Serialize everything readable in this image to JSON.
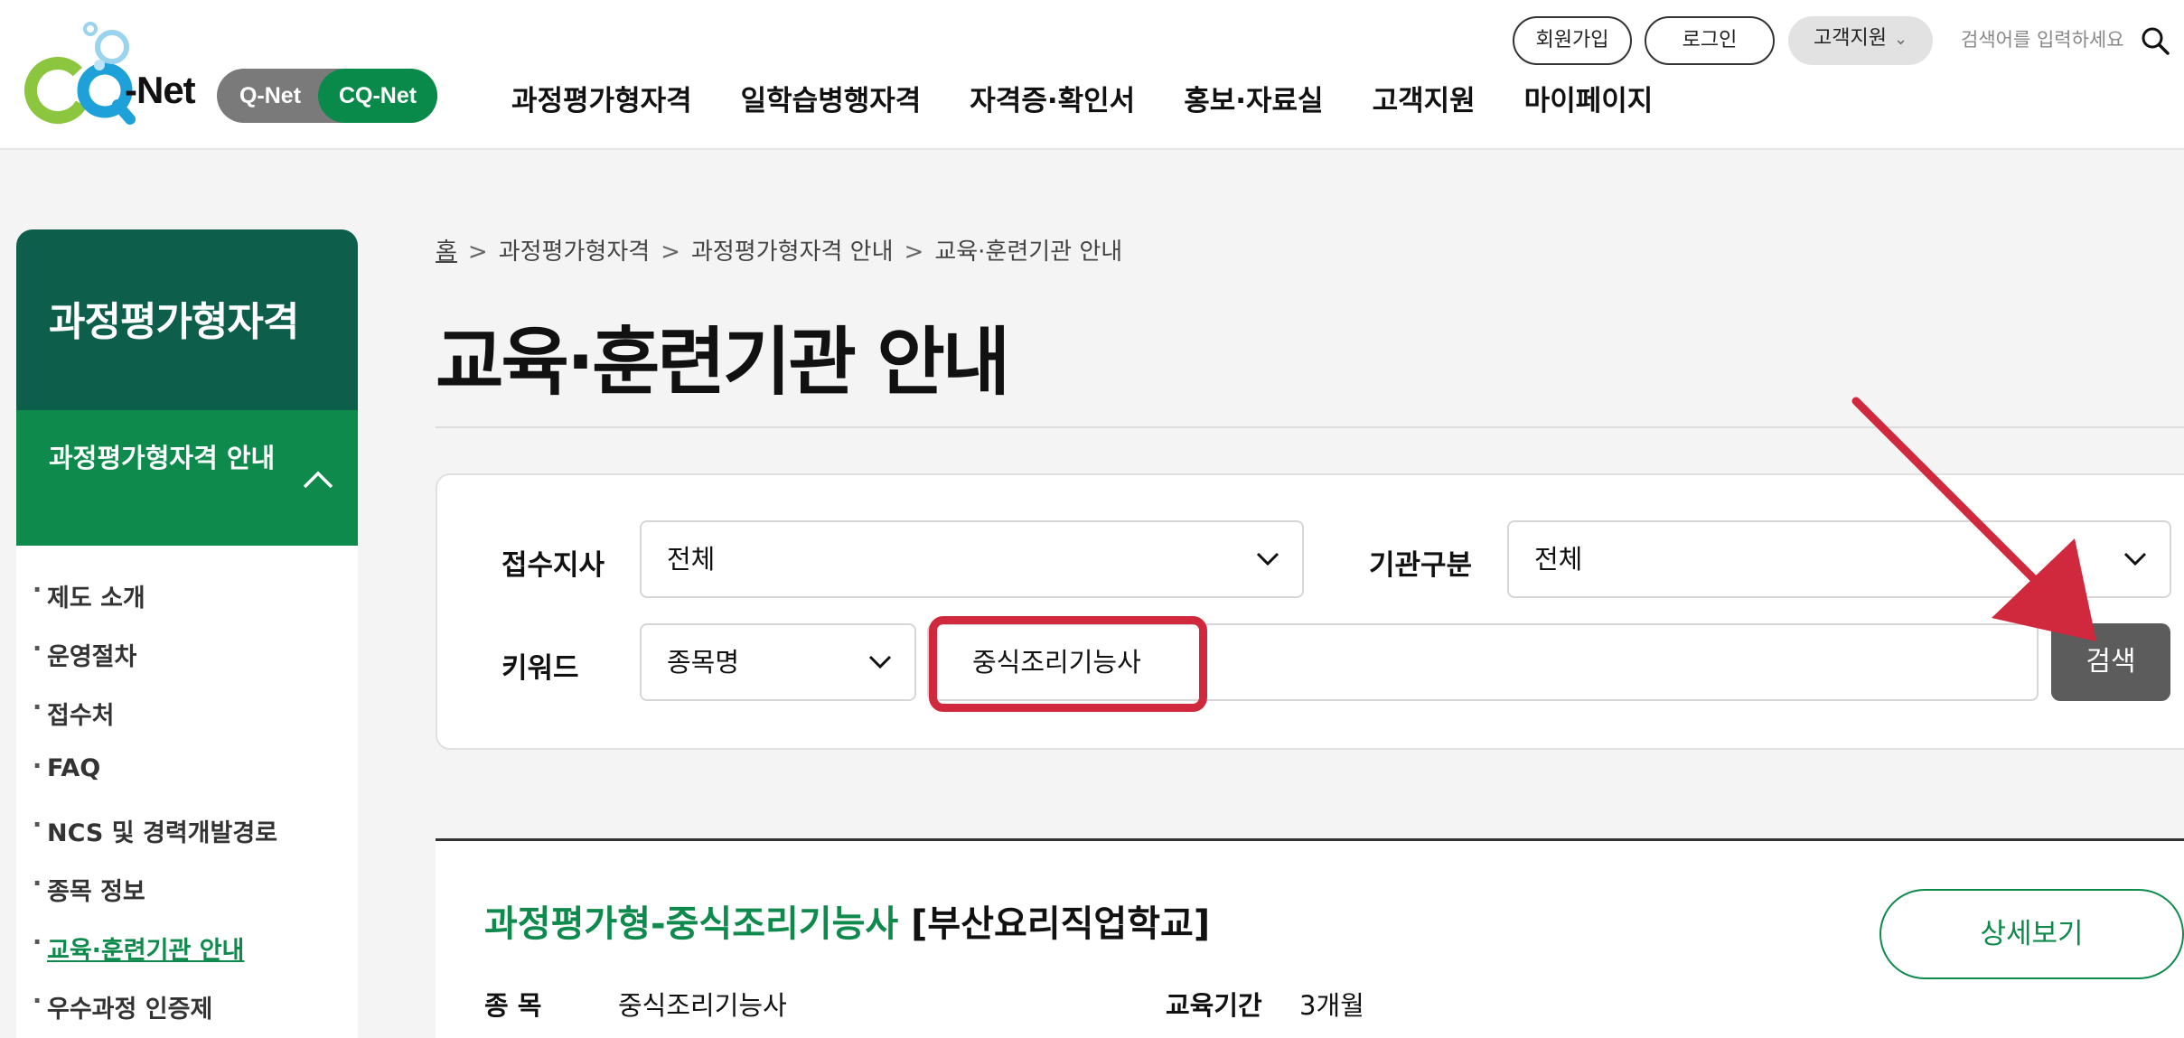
{
  "header": {
    "logo_text": "-Net",
    "switch": {
      "q_label": "Q-Net",
      "cq_label": "CQ-Net"
    },
    "gnb": [
      "과정평가형자격",
      "일학습병행자격",
      "자격증·확인서",
      "홍보·자료실",
      "고객지원",
      "마이페이지"
    ],
    "util": {
      "join": "회원가입",
      "login": "로그인",
      "support": "고객지원"
    },
    "search_placeholder": "검색어를 입력하세요"
  },
  "sidebar": {
    "title": "과정평가형자격",
    "section": "과정평가형자격 안내",
    "items": [
      "제도 소개",
      "운영절차",
      "접수처",
      "FAQ",
      "NCS 및 경력개발경로",
      "종목 정보",
      "교육·훈련기관 안내",
      "우수과정 인증제"
    ],
    "active_index": 6
  },
  "breadcrumb": [
    "홈",
    "과정평가형자격",
    "과정평가형자격 안내",
    "교육·훈련기관 안내"
  ],
  "page_title": "교육·훈련기관 안내",
  "filter": {
    "branch_label": "접수지사",
    "branch_value": "전체",
    "org_label": "기관구분",
    "org_value": "전체",
    "keyword_label": "키워드",
    "keyword_type": "종목명",
    "keyword_value": "중식조리기능사",
    "search_button": "검색"
  },
  "result": {
    "program": "과정평가형-중식조리기능사",
    "institution": "[부산요리직업학교]",
    "detail_button": "상세보기",
    "field_label": "종 목",
    "field_value": "중식조리기능사",
    "duration_label": "교육기간",
    "duration_value": "3개월"
  },
  "colors": {
    "brand_green": "#0e8a4c",
    "dark_green": "#0d5e4a",
    "annotation_red": "#d0283c",
    "search_button": "#5c5c5c"
  },
  "icons": {
    "top_search": "search-icon",
    "dropdown": "chevron-down-icon",
    "collapse": "chevron-up-icon"
  }
}
